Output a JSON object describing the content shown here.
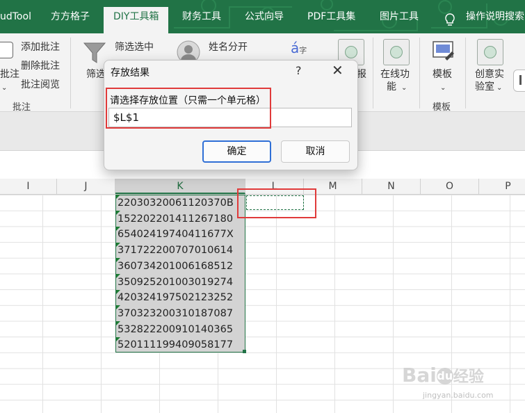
{
  "tabs": [
    {
      "label": "udTool"
    },
    {
      "label": "方方格子"
    },
    {
      "label": "DIY工具箱",
      "active": true
    },
    {
      "label": "财务工具"
    },
    {
      "label": "公式向导"
    },
    {
      "label": "PDF工具集"
    },
    {
      "label": "图片工具"
    },
    {
      "label": "操作说明搜索"
    }
  ],
  "ribbon": {
    "annot": {
      "add": "添加批注",
      "delete": "删除批注",
      "read": "批注阅览",
      "left_cut": "批注",
      "group": "批注"
    },
    "filter": {
      "label": "筛选选中",
      "big_label": "筛选"
    },
    "name_split": {
      "label": "姓名分开"
    },
    "report": {
      "label": "报"
    },
    "online": {
      "line1": "在线功",
      "line2": "能"
    },
    "template": {
      "label": "模板",
      "group": "模板"
    },
    "lab": {
      "line1": "创意实",
      "line2": "验室"
    }
  },
  "columns": [
    "I",
    "J",
    "K",
    "L",
    "M",
    "N",
    "O",
    "P"
  ],
  "cells_k": [
    "22030320061120370B",
    "152202201411267180",
    "65402419740411677X",
    "371722200707010614",
    "360734201006168512",
    "350925201003019274",
    "420324197502123252",
    "370323200310187087",
    "532822200910140365",
    "520111199409058177"
  ],
  "dialog": {
    "title": "存放结果",
    "help": "?",
    "close": "✕",
    "prompt": "请选择存放位置（只需一个单元格）",
    "value": "$L$1",
    "ok": "确定",
    "cancel": "取消"
  },
  "watermark": {
    "brand_a": "Bai",
    "brand_b": "du",
    "brand_c": "经验",
    "url": "jingyan.baidu.com"
  },
  "colors": {
    "excel_green": "#217346",
    "highlight_red": "#e03a3a",
    "focus_blue": "#2f6fd6"
  }
}
